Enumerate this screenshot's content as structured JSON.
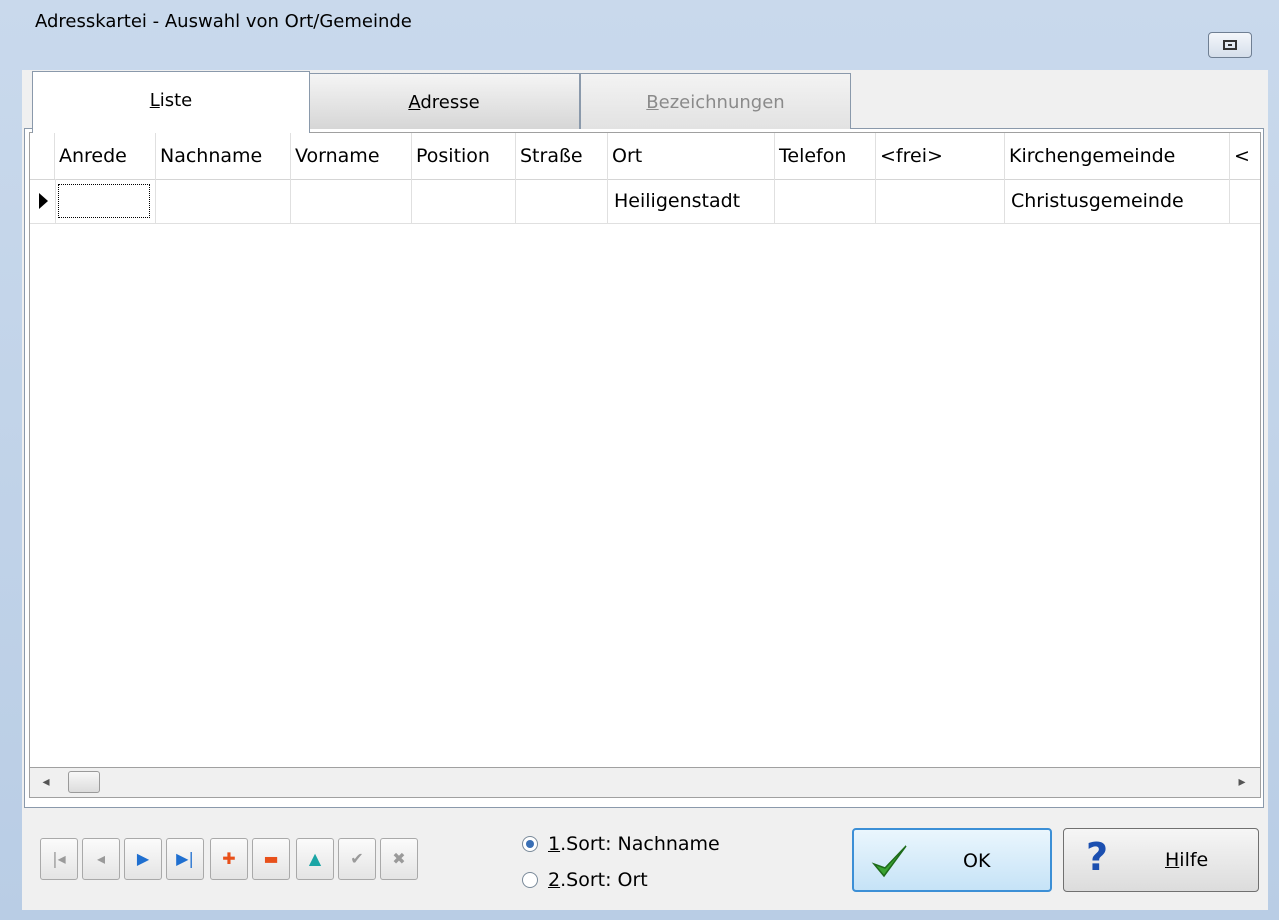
{
  "window": {
    "title": "Adresskartei - Auswahl von Ort/Gemeinde"
  },
  "tabs": [
    {
      "label": "Liste",
      "underline": "L",
      "rest": "iste",
      "state": "active"
    },
    {
      "label": "Adresse",
      "underline": "A",
      "rest": "dresse",
      "state": "normal"
    },
    {
      "label": "Bezeichnungen",
      "underline": "B",
      "rest": "ezeichnungen",
      "state": "disabled"
    }
  ],
  "grid": {
    "columns": [
      "Anrede",
      "Nachname",
      "Vorname",
      "Position",
      "Straße",
      "Ort",
      "Telefon",
      "<frei>",
      "Kirchengemeinde",
      "<"
    ],
    "rows": [
      {
        "Anrede": "",
        "Nachname": "",
        "Vorname": "",
        "Position": "",
        "Straße": "",
        "Ort": "Heiligenstadt",
        "Telefon": "",
        "frei": "",
        "Kirchengemeinde": "Christusgemeinde"
      }
    ]
  },
  "scrollbar": {
    "left_arrow": "◂",
    "right_arrow": "▸"
  },
  "navigator": {
    "buttons": [
      {
        "name": "first",
        "glyph": "|◂",
        "enabled": false,
        "color": "#9a9a9a"
      },
      {
        "name": "prior",
        "glyph": "◂",
        "enabled": false,
        "color": "#9a9a9a"
      },
      {
        "name": "next",
        "glyph": "▶",
        "enabled": true,
        "color": "#1f6fd0"
      },
      {
        "name": "last",
        "glyph": "▶|",
        "enabled": true,
        "color": "#1f6fd0"
      },
      {
        "name": "insert",
        "glyph": "✚",
        "enabled": true,
        "color": "#e8501a"
      },
      {
        "name": "delete",
        "glyph": "▬",
        "enabled": true,
        "color": "#e8501a"
      },
      {
        "name": "edit",
        "glyph": "▲",
        "enabled": true,
        "color": "#1aa5a5"
      },
      {
        "name": "post",
        "glyph": "✔",
        "enabled": false,
        "color": "#9a9a9a"
      },
      {
        "name": "cancel",
        "glyph": "✖",
        "enabled": false,
        "color": "#9a9a9a"
      }
    ]
  },
  "sort": {
    "options": [
      {
        "key": "1",
        "label": ".Sort: Nachname",
        "selected": true
      },
      {
        "key": "2",
        "label": ".Sort: Ort",
        "selected": false
      }
    ]
  },
  "buttons": {
    "ok": {
      "label": "OK",
      "icon": "checkmark-icon",
      "icon_color": "#3aa232"
    },
    "help": {
      "label_underline": "H",
      "label_rest": "ilfe",
      "icon": "question-icon",
      "icon_color": "#1b4fb0"
    }
  }
}
